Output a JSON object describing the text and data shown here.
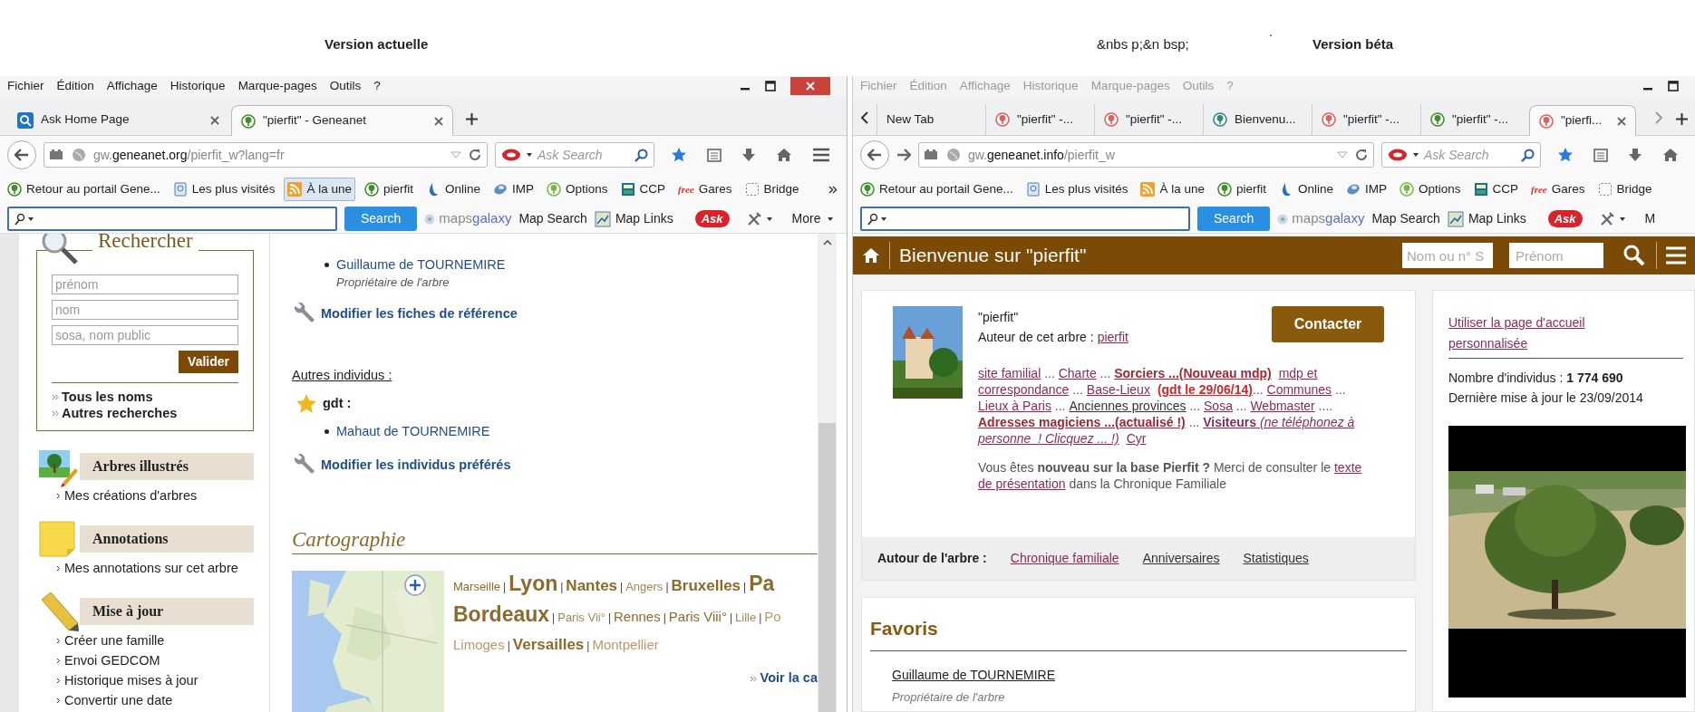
{
  "page_header": {
    "left_title": "Version actuelle",
    "dot": ".",
    "right_prefix": "&nbs p;&n bsp;",
    "right_title": "Version béta"
  },
  "left_window": {
    "focused": true,
    "menu": [
      "Fichier",
      "Édition",
      "Affichage",
      "Historique",
      "Marque-pages",
      "Outils",
      "?"
    ],
    "tabs_scroll": false,
    "tabs": [
      {
        "label": "Ask Home Page",
        "kind": "search",
        "selected": false,
        "close_button": true
      },
      {
        "label": "\"pierfit\" - Geneanet",
        "kind": "tree",
        "color": "#3f8f2a",
        "selected": true,
        "close_button": true
      }
    ],
    "nav": {
      "forward": false,
      "url_start": "gw.",
      "url_domain": "geneanet.org",
      "url_end": "/pierfit_w?lang=fr",
      "search_placeholder": "Ask Search",
      "menu_button": true
    },
    "bookmarks": [
      {
        "label": "Retour au portail Gene...",
        "kind": "tree",
        "color": "#3f8f2a",
        "selected": false
      },
      {
        "label": "Les plus visités",
        "kind": "page",
        "selected": false
      },
      {
        "label": "À la une",
        "kind": "rss",
        "selected": true
      },
      {
        "label": "pierfit",
        "kind": "tree",
        "color": "#3f8f2a",
        "selected": false
      },
      {
        "label": "Online",
        "kind": "drop",
        "selected": false
      },
      {
        "label": "IMP",
        "kind": "globe",
        "selected": false
      },
      {
        "label": "Options",
        "kind": "tree",
        "color": "#7ab648",
        "selected": false
      },
      {
        "label": "CCP",
        "kind": "calculator",
        "selected": false
      },
      {
        "label": "Gares",
        "kind": "badge",
        "badge": "free",
        "selected": false
      },
      {
        "label": "Bridge",
        "kind": "frame",
        "selected": false
      }
    ],
    "bookmarks_overflow": true,
    "toolbar": {
      "search_button": "Search",
      "brand_start": "maps",
      "brand_end": "galaxy",
      "map_search": "Map Search",
      "map_links": "Map Links",
      "ask": "Ask",
      "more": "More"
    },
    "sidebar": {
      "search_title": "Rechercher",
      "fields": [
        {
          "placeholder": "prénom"
        },
        {
          "placeholder": "nom"
        },
        {
          "placeholder": "sosa, nom public"
        }
      ],
      "submit": "Valider",
      "links": [
        "Tous les noms",
        "Autres recherches"
      ],
      "sections": [
        {
          "title": "Arbres illustrés",
          "kind": "picture",
          "links": [
            "Mes créations d'arbres"
          ]
        },
        {
          "title": "Annotations",
          "kind": "note",
          "links": [
            "Mes annotations sur cet arbre"
          ]
        },
        {
          "title": "Mise à jour",
          "kind": "pencil",
          "links": [
            "Créer une famille",
            "Envoi GEDCOM",
            "Historique mises à jour",
            "Convertir une date"
          ]
        }
      ]
    },
    "main": {
      "owner": {
        "name": "Guillaume de TOURNEMIRE",
        "role": "Propriétaire de l'arbre"
      },
      "edit_reference": "Modifier les fiches de référence",
      "others_label": "Autres individus :",
      "group": {
        "name": "gdt :",
        "members": [
          "Mahaut de TOURNEMIRE"
        ]
      },
      "edit_preferred": "Modifier les individus préférés",
      "cartography": {
        "title": "Cartographie",
        "lines": [
          {
            "cities": [
              {
                "label": "Marseille",
                "kind": "minor",
                "sep": "|"
              },
              {
                "label": "Lyon",
                "kind": "capital",
                "sep": "|"
              },
              {
                "label": "Nantes",
                "kind": "major",
                "sep": "|"
              },
              {
                "label": "Angers",
                "kind": "faint",
                "sep": "|"
              },
              {
                "label": "Bruxelles",
                "kind": "major",
                "sep": "|"
              },
              {
                "label": "Pa",
                "kind": "capital"
              }
            ]
          },
          {
            "cities": [
              {
                "label": "Bordeaux",
                "kind": "capital",
                "sep": "|"
              },
              {
                "label": "Paris Vii°",
                "kind": "faint",
                "sep": "|"
              },
              {
                "label": "Rennes",
                "kind": "normal",
                "sep": "|"
              },
              {
                "label": "Paris Viii°",
                "kind": "normal",
                "sep": "|"
              },
              {
                "label": "Lille",
                "kind": "faint",
                "sep": "|"
              },
              {
                "label": "Po",
                "kind": "pale"
              }
            ]
          },
          {
            "cities": [
              {
                "label": "Limoges",
                "kind": "pale",
                "sep": "|"
              },
              {
                "label": "Versailles",
                "kind": "major",
                "sep": "|"
              },
              {
                "label": "Montpellier",
                "kind": "pale"
              }
            ]
          }
        ],
        "more": "Voir la ca"
      }
    }
  },
  "right_window": {
    "focused": false,
    "menu": [
      "Fichier",
      "Édition",
      "Affichage",
      "Historique",
      "Marque-pages",
      "Outils",
      "?"
    ],
    "tabs_scroll": true,
    "tabs": [
      {
        "label": "New Tab",
        "kind": "blank",
        "selected": false,
        "close_button": false
      },
      {
        "label": "\"pierfit\" -...",
        "kind": "tree",
        "color": "#e0605a",
        "selected": false,
        "close_button": false
      },
      {
        "label": "\"pierfit\" -...",
        "kind": "tree",
        "color": "#e0605a",
        "selected": false,
        "close_button": false
      },
      {
        "label": "Bienvenu...",
        "kind": "tree",
        "color": "#2e8a78",
        "selected": false,
        "close_button": false
      },
      {
        "label": "\"pierfit\" -...",
        "kind": "tree",
        "color": "#e0605a",
        "selected": false,
        "close_button": false
      },
      {
        "label": "\"pierfit\" -...",
        "kind": "tree",
        "color": "#3f8f2a",
        "selected": false,
        "close_button": false
      },
      {
        "label": "\"pierfi...",
        "kind": "tree",
        "color": "#e0605a",
        "selected": true,
        "close_button": true
      }
    ],
    "nav": {
      "forward": true,
      "url_start": "gw.",
      "url_domain": "geneanet.info",
      "url_end": "/pierfit_w",
      "search_placeholder": "Ask Search",
      "menu_button": false
    },
    "bookmarks": [
      {
        "label": "Retour au portail Gene...",
        "kind": "tree",
        "color": "#3f8f2a",
        "selected": false
      },
      {
        "label": "Les plus visités",
        "kind": "page",
        "selected": false
      },
      {
        "label": "À la une",
        "kind": "rss",
        "selected": false
      },
      {
        "label": "pierfit",
        "kind": "tree",
        "color": "#3f8f2a",
        "selected": false
      },
      {
        "label": "Online",
        "kind": "drop",
        "selected": false
      },
      {
        "label": "IMP",
        "kind": "globe",
        "selected": false
      },
      {
        "label": "Options",
        "kind": "tree",
        "color": "#7ab648",
        "selected": false
      },
      {
        "label": "CCP",
        "kind": "calculator",
        "selected": false
      },
      {
        "label": "Gares",
        "kind": "badge",
        "badge": "free",
        "selected": false
      },
      {
        "label": "Bridge",
        "kind": "frame",
        "selected": false
      }
    ],
    "bookmarks_overflow": false,
    "toolbar": {
      "search_button": "Search",
      "brand_start": "maps",
      "brand_end": "galaxy",
      "map_search": "Map Search",
      "map_links": "Map Links",
      "ask": "Ask",
      "more": "M"
    },
    "site_header": {
      "title": "Bienvenue sur \"pierfit\"",
      "name_placeholder": "Nom ou n° S",
      "first_name_placeholder": "Prénom"
    },
    "tree_card": {
      "tree_name": "\"pierfit\"",
      "author_label": "Auteur de cet arbre :",
      "author": "pierfit",
      "contact": "Contacter",
      "links": [
        [
          {
            "kind": "link",
            "text": "site familial"
          },
          {
            "kind": "text",
            "text": " ... "
          },
          {
            "kind": "link",
            "text": "Charte"
          },
          {
            "kind": "text",
            "text": " ... "
          },
          {
            "kind": "strong-link",
            "text": "Sorciers ...(Nouveau mdp)"
          },
          {
            "kind": "link",
            "text": "mdp et",
            "spaced": true
          }
        ],
        [
          {
            "kind": "link",
            "text": "correspondance"
          },
          {
            "kind": "text",
            "text": " ... "
          },
          {
            "kind": "link",
            "text": "Base-Lieux"
          },
          {
            "kind": "alert-link",
            "text": "(gdt le 29/06/14)",
            "spaced": true
          },
          {
            "kind": "text",
            "text": "... "
          },
          {
            "kind": "link",
            "text": "Communes"
          },
          {
            "kind": "text",
            "text": " ..."
          }
        ],
        [
          {
            "kind": "link",
            "text": "Lieux à Paris"
          },
          {
            "kind": "text",
            "text": " ... "
          },
          {
            "kind": "dark-link",
            "text": "Anciennes provinces"
          },
          {
            "kind": "text",
            "text": " ... "
          },
          {
            "kind": "link",
            "text": "Sosa"
          },
          {
            "kind": "text",
            "text": " ... "
          },
          {
            "kind": "link",
            "text": "Webmaster"
          },
          {
            "kind": "text",
            "text": " ...."
          }
        ],
        [
          {
            "kind": "strong-link",
            "text": "Adresses magiciens ...(actualisé !)"
          },
          {
            "kind": "text",
            "text": " ... "
          },
          {
            "kind": "link",
            "text": "**Visiteurs** *(ne téléphonez à*"
          }
        ],
        [
          {
            "kind": "link",
            "text": "*personne  ! Clicquez ... !)*"
          },
          {
            "kind": "link",
            "text": "Cyr",
            "spaced": true
          }
        ]
      ],
      "intro": [
        [
          {
            "kind": "text",
            "text": "Vous êtes **nouveau sur la base Pierfit ?** Merci de consulter le "
          },
          {
            "kind": "link",
            "text": "texte"
          }
        ],
        [
          {
            "kind": "link",
            "text": "de présentation"
          },
          {
            "kind": "text",
            "text": " dans la Chronique Familiale"
          }
        ]
      ],
      "around_label": "Autour de l'arbre :",
      "around_links": [
        {
          "label": "Chronique familiale",
          "kind": "link"
        },
        {
          "label": "Anniversaires",
          "kind": "dark-link"
        },
        {
          "label": "Statistiques",
          "kind": "dark-link"
        }
      ]
    },
    "favorites": {
      "title": "Favoris",
      "items": [
        {
          "name": "Guillaume de TOURNEMIRE",
          "role": "Propriétaire de l'arbre"
        }
      ]
    },
    "side_card": {
      "home_link": "Utiliser la page d'accueil personnalisée",
      "count": "Nombre d'individus : **1 774 690**",
      "updated": "Dernière mise à jour le 23/09/2014"
    }
  }
}
